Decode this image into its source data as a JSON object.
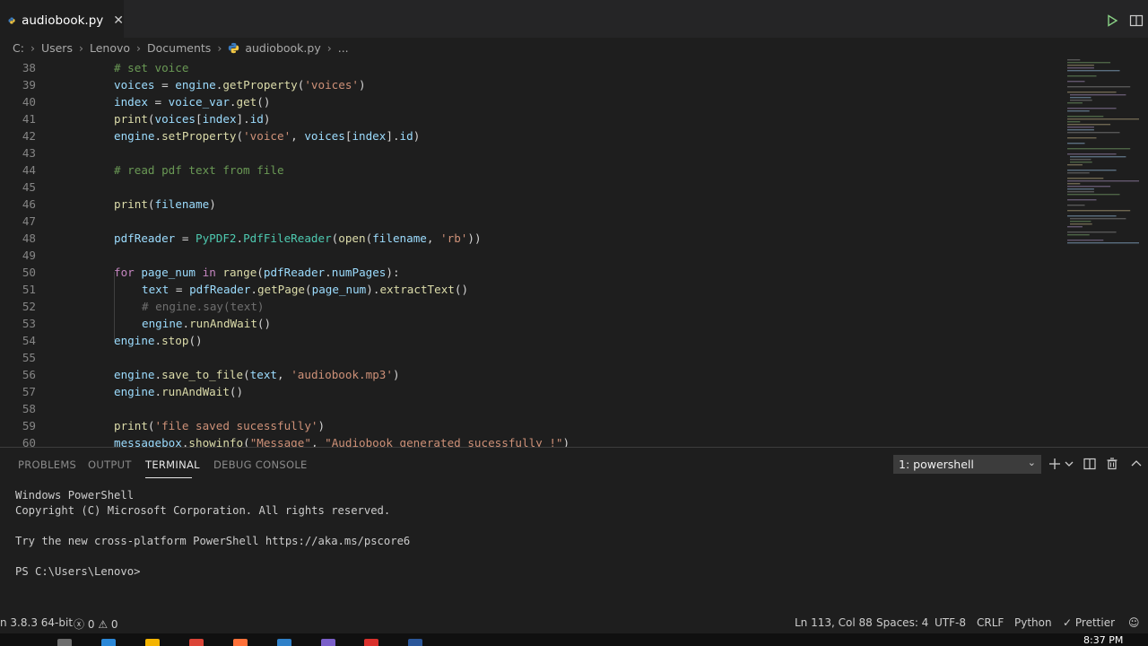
{
  "tab": {
    "filename": "audiobook.py",
    "close_glyph": "✕"
  },
  "breadcrumb": {
    "segments": [
      "C:",
      "Users",
      "Lenovo",
      "Documents"
    ],
    "file": "audiobook.py",
    "tail": "..."
  },
  "editor": {
    "lines": [
      {
        "n": "38",
        "indent": 1,
        "tokens": [
          [
            "cm",
            "# set voice"
          ]
        ]
      },
      {
        "n": "39",
        "indent": 1,
        "tokens": [
          [
            "var",
            "voices"
          ],
          [
            "",
            " = "
          ],
          [
            "var",
            "engine"
          ],
          [
            "",
            "."
          ],
          [
            "fn",
            "getProperty"
          ],
          [
            "",
            "("
          ],
          [
            "str",
            "'voices'"
          ],
          [
            "",
            ")"
          ]
        ]
      },
      {
        "n": "40",
        "indent": 1,
        "tokens": [
          [
            "var",
            "index"
          ],
          [
            "",
            " = "
          ],
          [
            "var",
            "voice_var"
          ],
          [
            "",
            "."
          ],
          [
            "fn",
            "get"
          ],
          [
            "",
            "()"
          ]
        ]
      },
      {
        "n": "41",
        "indent": 1,
        "tokens": [
          [
            "fn",
            "print"
          ],
          [
            "",
            "("
          ],
          [
            "var",
            "voices"
          ],
          [
            "",
            "["
          ],
          [
            "var",
            "index"
          ],
          [
            "",
            "]."
          ],
          [
            "var",
            "id"
          ],
          [
            "",
            ")"
          ]
        ]
      },
      {
        "n": "42",
        "indent": 1,
        "tokens": [
          [
            "var",
            "engine"
          ],
          [
            "",
            "."
          ],
          [
            "fn",
            "setProperty"
          ],
          [
            "",
            "("
          ],
          [
            "str",
            "'voice'"
          ],
          [
            "",
            ", "
          ],
          [
            "var",
            "voices"
          ],
          [
            "",
            "["
          ],
          [
            "var",
            "index"
          ],
          [
            "",
            "]."
          ],
          [
            "var",
            "id"
          ],
          [
            "",
            ")"
          ]
        ]
      },
      {
        "n": "43",
        "indent": 1,
        "tokens": []
      },
      {
        "n": "44",
        "indent": 1,
        "tokens": [
          [
            "cm",
            "# read pdf text from file"
          ]
        ]
      },
      {
        "n": "45",
        "indent": 1,
        "tokens": []
      },
      {
        "n": "46",
        "indent": 1,
        "tokens": [
          [
            "fn",
            "print"
          ],
          [
            "",
            "("
          ],
          [
            "var",
            "filename"
          ],
          [
            "",
            ")"
          ]
        ]
      },
      {
        "n": "47",
        "indent": 1,
        "tokens": []
      },
      {
        "n": "48",
        "indent": 1,
        "tokens": [
          [
            "var",
            "pdfReader"
          ],
          [
            "",
            " = "
          ],
          [
            "cls",
            "PyPDF2"
          ],
          [
            "",
            "."
          ],
          [
            "cls",
            "PdfFileReader"
          ],
          [
            "",
            "("
          ],
          [
            "fn",
            "open"
          ],
          [
            "",
            "("
          ],
          [
            "var",
            "filename"
          ],
          [
            "",
            ", "
          ],
          [
            "str",
            "'rb'"
          ],
          [
            "",
            "))"
          ]
        ]
      },
      {
        "n": "49",
        "indent": 1,
        "tokens": []
      },
      {
        "n": "50",
        "indent": 1,
        "tokens": [
          [
            "kw",
            "for"
          ],
          [
            "",
            " "
          ],
          [
            "var",
            "page_num"
          ],
          [
            "",
            " "
          ],
          [
            "kw",
            "in"
          ],
          [
            "",
            " "
          ],
          [
            "fn",
            "range"
          ],
          [
            "",
            "("
          ],
          [
            "var",
            "pdfReader"
          ],
          [
            "",
            "."
          ],
          [
            "var",
            "numPages"
          ],
          [
            "",
            "):"
          ]
        ]
      },
      {
        "n": "51",
        "indent": 2,
        "tokens": [
          [
            "var",
            "text"
          ],
          [
            "",
            " = "
          ],
          [
            "var",
            "pdfReader"
          ],
          [
            "",
            "."
          ],
          [
            "fn",
            "getPage"
          ],
          [
            "",
            "("
          ],
          [
            "var",
            "page_num"
          ],
          [
            "",
            ")."
          ],
          [
            "fn",
            "extractText"
          ],
          [
            "",
            "()"
          ]
        ]
      },
      {
        "n": "52",
        "indent": 2,
        "tokens": [
          [
            "dim",
            "# engine.say(text)"
          ]
        ]
      },
      {
        "n": "53",
        "indent": 2,
        "tokens": [
          [
            "var",
            "engine"
          ],
          [
            "",
            "."
          ],
          [
            "fn",
            "runAndWait"
          ],
          [
            "",
            "()"
          ]
        ]
      },
      {
        "n": "54",
        "indent": 1,
        "tokens": [
          [
            "var",
            "engine"
          ],
          [
            "",
            "."
          ],
          [
            "fn",
            "stop"
          ],
          [
            "",
            "()"
          ]
        ]
      },
      {
        "n": "55",
        "indent": 1,
        "tokens": []
      },
      {
        "n": "56",
        "indent": 1,
        "tokens": [
          [
            "var",
            "engine"
          ],
          [
            "",
            "."
          ],
          [
            "fn",
            "save_to_file"
          ],
          [
            "",
            "("
          ],
          [
            "var",
            "text"
          ],
          [
            "",
            ", "
          ],
          [
            "str",
            "'audiobook.mp3'"
          ],
          [
            "",
            ")"
          ]
        ]
      },
      {
        "n": "57",
        "indent": 1,
        "tokens": [
          [
            "var",
            "engine"
          ],
          [
            "",
            "."
          ],
          [
            "fn",
            "runAndWait"
          ],
          [
            "",
            "()"
          ]
        ]
      },
      {
        "n": "58",
        "indent": 1,
        "tokens": []
      },
      {
        "n": "59",
        "indent": 1,
        "tokens": [
          [
            "fn",
            "print"
          ],
          [
            "",
            "("
          ],
          [
            "str",
            "'file saved sucessfully'"
          ],
          [
            "",
            ")"
          ]
        ]
      },
      {
        "n": "60",
        "indent": 1,
        "tokens": [
          [
            "var",
            "messagebox"
          ],
          [
            "",
            "."
          ],
          [
            "fn",
            "showinfo"
          ],
          [
            "",
            "("
          ],
          [
            "str",
            "\"Message\""
          ],
          [
            "",
            ", "
          ],
          [
            "str",
            "\"Audiobook generated sucessfully !\""
          ],
          [
            "",
            ")"
          ]
        ]
      }
    ]
  },
  "panel": {
    "tabs": [
      "PROBLEMS",
      "OUTPUT",
      "TERMINAL",
      "DEBUG CONSOLE"
    ],
    "active_tab": "TERMINAL",
    "terminal_select": "1: powershell",
    "terminal_lines": [
      "Windows PowerShell",
      "Copyright (C) Microsoft Corporation. All rights reserved.",
      "",
      "Try the new cross-platform PowerShell https://aka.ms/pscore6",
      "",
      "PS C:\\Users\\Lenovo>"
    ]
  },
  "statusbar": {
    "interpreter": "n 3.8.3 64-bit",
    "errors": "0",
    "warnings": "0",
    "position": "Ln 113, Col 88",
    "spaces": "Spaces: 4",
    "encoding": "UTF-8",
    "eol": "CRLF",
    "language": "Python",
    "formatter": "Prettier"
  },
  "taskbar": {
    "clock": "8:37 PM"
  },
  "colors": {
    "editor_bg": "#1e1e1e",
    "tab_bar_bg": "#252526",
    "comment": "#6a9955",
    "string": "#ce9178",
    "function": "#dcdcaa",
    "keyword": "#c586c0",
    "variable": "#9cdcfe",
    "class": "#4ec9b0"
  }
}
